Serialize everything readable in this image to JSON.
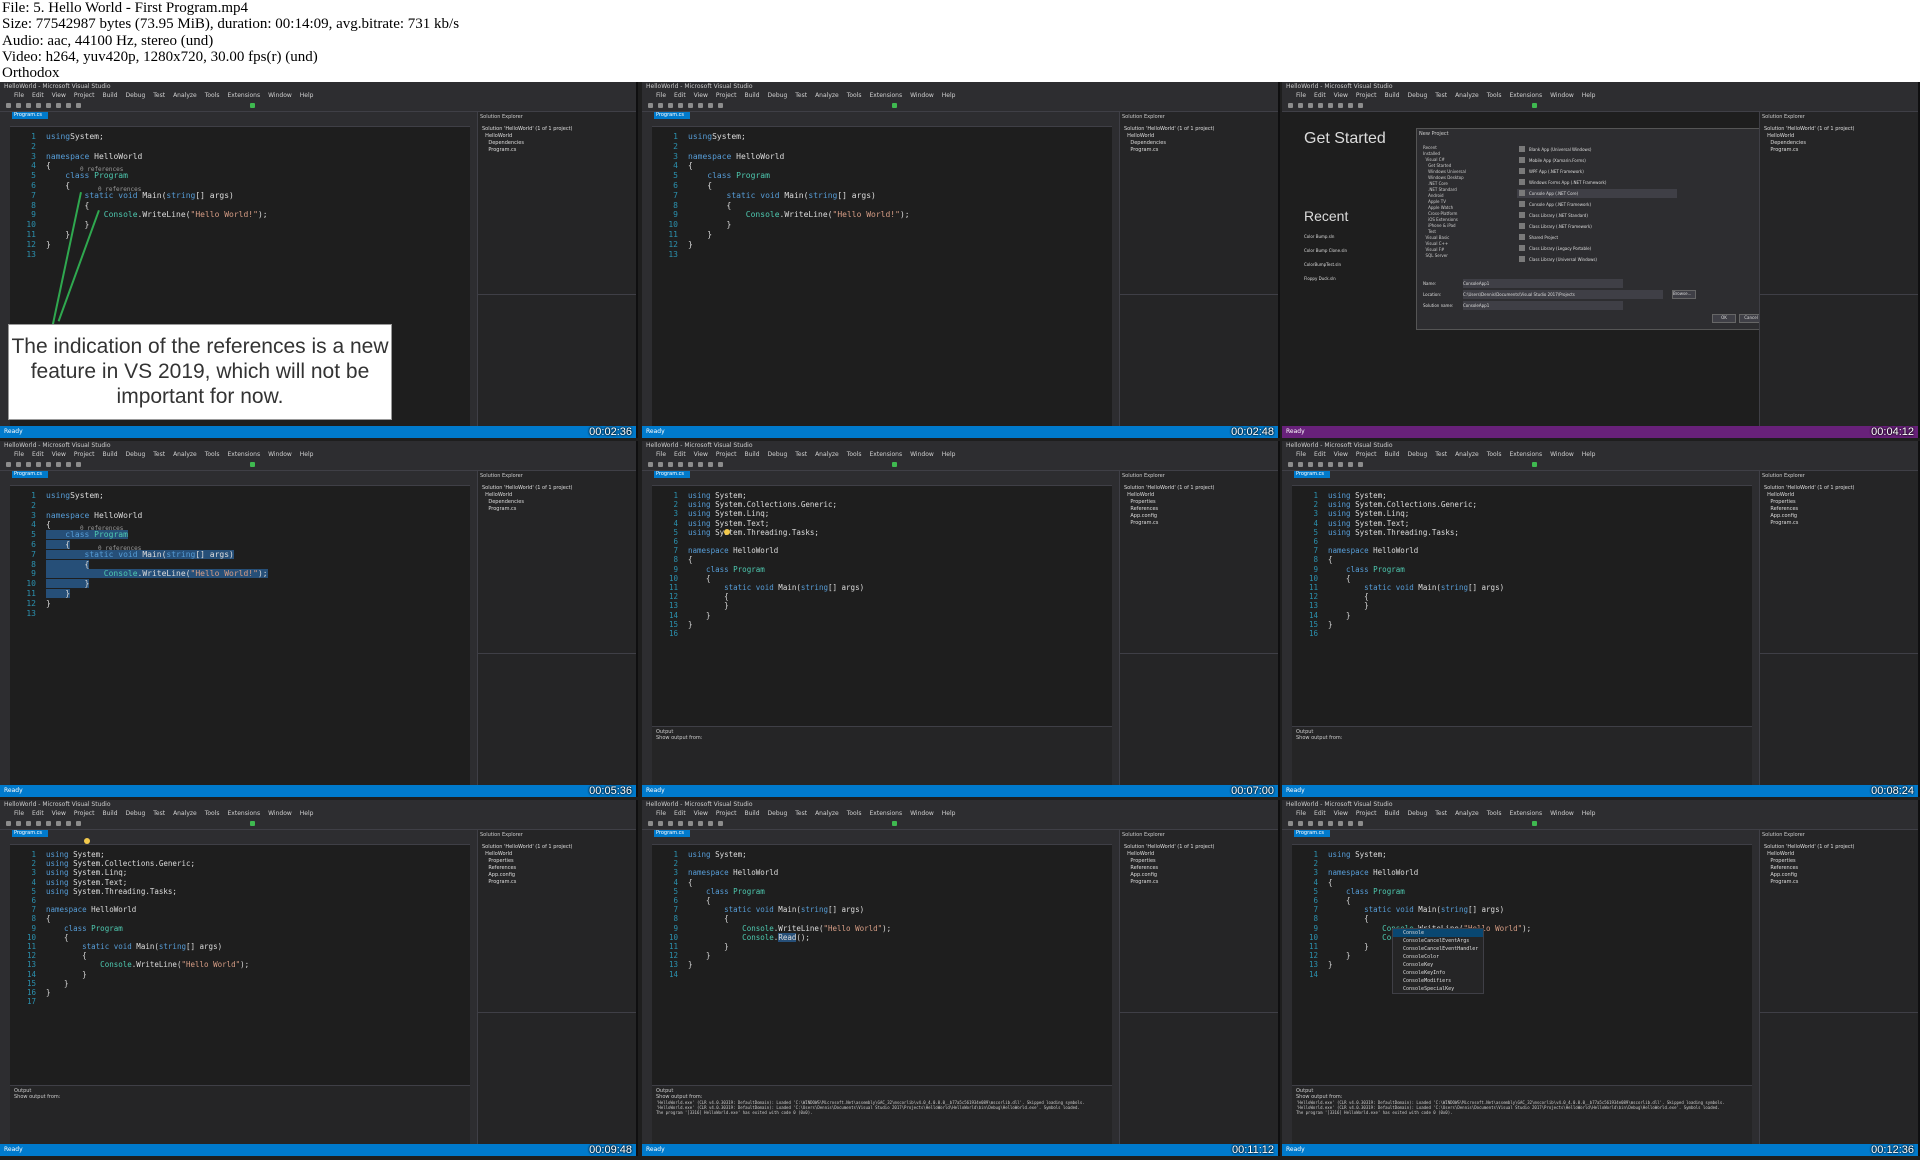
{
  "header": {
    "lines": [
      "File: 5. Hello World - First Program.mp4",
      "Size: 77542987 bytes (73.95 MiB), duration: 00:14:09, avg.bitrate: 731 kb/s",
      "Audio: aac, 44100 Hz, stereo (und)",
      "Video: h264, yuv420p, 1280x720, 30.00 fps(r) (und)",
      "Orthodox"
    ]
  },
  "menu": [
    "File",
    "Edit",
    "View",
    "Project",
    "Build",
    "Debug",
    "Test",
    "Analyze",
    "Tools",
    "Extensions",
    "Window",
    "Help"
  ],
  "app_title": "HelloWorld - Microsoft Visual Studio",
  "tab_label": "Program.cs",
  "status_ready": "Ready",
  "solution_explorer": {
    "title": "Solution Explorer",
    "core_tree": "Solution 'HelloWorld' (1 of 1 project)\n  HelloWorld\n    Dependencies\n    Program.cs",
    "fx_tree": "Solution 'HelloWorld' (1 of 1 project)\n  HelloWorld\n    Properties\n    References\n    App.config\n    Program.cs"
  },
  "output": {
    "label": "Output",
    "show_from": "Show output from:",
    "debug_text": "'HelloWorld.exe' (CLR v4.0.30319: DefaultDomain): Loaded 'C:\\WINDOWS\\Microsoft.Net\\assembly\\GAC_32\\mscorlib\\v4.0_4.0.0.0__b77a5c561934e089\\mscorlib.dll'. Skipped loading symbols.\n'HelloWorld.exe' (CLR v4.0.30319: DefaultDomain): Loaded 'C:\\Users\\Dennis\\Documents\\Visual Studio 2017\\Projects\\HelloWorld\\HelloWorld\\bin\\Debug\\HelloWorld.exe'. Symbols loaded.\nThe program '[3316] HelloWorld.exe' has exited with code 0 (0x0)."
  },
  "callout": "The indication of the references is a new feature in VS 2019, which will not be important for now.",
  "references_label": "0 references",
  "frames": [
    {
      "timestamp": "00:02:36",
      "lines": [
        [
          [
            "kw",
            "using"
          ],
          [
            "",
            "System;"
          ]
        ],
        [
          [
            "",
            ""
          ]
        ],
        [
          [
            "kw",
            "namespace"
          ],
          [
            "",
            " HelloWorld"
          ]
        ],
        [
          [
            "",
            "{"
          ]
        ],
        [
          [
            "kw",
            "    class"
          ],
          [
            "ty",
            " Program"
          ]
        ],
        [
          [
            "",
            "    {"
          ]
        ],
        [
          [
            "kw",
            "        static void"
          ],
          [
            "",
            " Main("
          ],
          [
            "kw",
            "string"
          ],
          [
            "",
            "[] args)"
          ]
        ],
        [
          [
            "",
            "        {"
          ]
        ],
        [
          [
            "ty",
            "            Console"
          ],
          [
            "",
            ".WriteLine("
          ],
          [
            "st",
            "\"Hello World!\""
          ],
          [
            "",
            ");"
          ]
        ],
        [
          [
            "",
            "        }"
          ]
        ],
        [
          [
            "",
            "    }"
          ]
        ],
        [
          [
            "",
            "}"
          ]
        ],
        [
          [
            "",
            ""
          ]
        ]
      ]
    },
    {
      "timestamp": "00:02:48",
      "lines": [
        [
          [
            "kw",
            "using"
          ],
          [
            "",
            "System;"
          ]
        ],
        [
          [
            "",
            ""
          ]
        ],
        [
          [
            "kw",
            "namespace"
          ],
          [
            "",
            " HelloWorld"
          ]
        ],
        [
          [
            "",
            "{"
          ]
        ],
        [
          [
            "kw",
            "    class"
          ],
          [
            "ty",
            " Program"
          ]
        ],
        [
          [
            "",
            "    {"
          ]
        ],
        [
          [
            "kw",
            "        static void"
          ],
          [
            "",
            " Main("
          ],
          [
            "kw",
            "string"
          ],
          [
            "",
            "[] args)"
          ]
        ],
        [
          [
            "",
            "        {"
          ]
        ],
        [
          [
            "ty",
            "            Console"
          ],
          [
            "",
            ".WriteLine("
          ],
          [
            "st",
            "\"Hello World!\""
          ],
          [
            "",
            ");"
          ]
        ],
        [
          [
            "",
            "        }"
          ]
        ],
        [
          [
            "",
            "    }"
          ]
        ],
        [
          [
            "",
            "}"
          ]
        ],
        [
          [
            "",
            ""
          ]
        ]
      ]
    },
    {
      "timestamp": "00:04:12",
      "get_started": "Get Started",
      "recent": "Recent",
      "dialog_title": "New Project",
      "templates": [
        "Blank App (Universal Windows)",
        "Mobile App (Xamarin.Forms)",
        "WPF App (.NET Framework)",
        "Windows Forms App (.NET Framework)",
        "Console App (.NET Core)",
        "Console App (.NET Framework)",
        "Class Library (.NET Standard)",
        "Class Library (.NET Framework)",
        "Shared Project",
        "Class Library (Legacy Portable)",
        "Class Library (Universal Windows)"
      ],
      "recent_items": [
        "Color Bump.sln",
        "Color Bump Clone.sln",
        "ColorBumpTest.sln",
        "Floppy Duck.sln"
      ],
      "tree": "Recent\nInstalled\n  Visual C#\n    Get Started\n    Windows Universal\n    Windows Desktop\n    .NET Core\n    .NET Standard\n    Android\n    Apple TV\n    Apple Watch\n    Cross-Platform\n    iOS Extensions\n    iPhone & iPad\n    Test\n  Visual Basic\n  Visual C++\n  Visual F#\n  SQL Server",
      "field_name": "Name:",
      "field_location": "Location:",
      "field_solution": "Solution name:",
      "value_name": "ConsoleApp1",
      "value_location": "C:\\Users\\Dennis\\Documents\\Visual Studio 2017\\Projects",
      "browse": "Browse...",
      "ok": "OK",
      "cancel": "Cancel"
    },
    {
      "timestamp": "00:05:36",
      "lines": [
        [
          [
            "kw",
            "using"
          ],
          [
            "",
            "System;"
          ]
        ],
        [
          [
            "",
            ""
          ]
        ],
        [
          [
            "kw",
            "namespace"
          ],
          [
            "",
            " HelloWorld"
          ]
        ],
        [
          [
            "",
            "{"
          ]
        ],
        [
          [
            "kw",
            "    class"
          ],
          [
            "ty",
            " Program"
          ]
        ],
        [
          [
            "",
            "    {"
          ]
        ],
        [
          [
            "kw",
            "        static void"
          ],
          [
            "",
            " Main("
          ],
          [
            "kw",
            "string"
          ],
          [
            "",
            "[] args)"
          ]
        ],
        [
          [
            "",
            "        {"
          ]
        ],
        [
          [
            "ty",
            "            Console"
          ],
          [
            "",
            ".WriteLine("
          ],
          [
            "st",
            "\"Hello World!\""
          ],
          [
            "",
            ");"
          ]
        ],
        [
          [
            "",
            "        }"
          ]
        ],
        [
          [
            "",
            "    }"
          ]
        ],
        [
          [
            "",
            "}"
          ]
        ],
        [
          [
            "",
            ""
          ]
        ]
      ]
    },
    {
      "timestamp": "00:07:00",
      "lines": [
        [
          [
            "kw",
            "using"
          ],
          [
            "",
            " System;"
          ]
        ],
        [
          [
            "kw",
            "using"
          ],
          [
            "",
            " System.Collections.Generic;"
          ]
        ],
        [
          [
            "kw",
            "using"
          ],
          [
            "",
            " System.Linq;"
          ]
        ],
        [
          [
            "kw",
            "using"
          ],
          [
            "",
            " System.Text;"
          ]
        ],
        [
          [
            "kw",
            "using"
          ],
          [
            "",
            " System.Threading.Tasks;"
          ]
        ],
        [
          [
            "",
            ""
          ]
        ],
        [
          [
            "kw",
            "namespace"
          ],
          [
            "",
            " HelloWorld"
          ]
        ],
        [
          [
            "",
            "{"
          ]
        ],
        [
          [
            "kw",
            "    class"
          ],
          [
            "ty",
            " Program"
          ]
        ],
        [
          [
            "",
            "    {"
          ]
        ],
        [
          [
            "kw",
            "        static void"
          ],
          [
            "",
            " Main("
          ],
          [
            "kw",
            "string"
          ],
          [
            "",
            "[] args)"
          ]
        ],
        [
          [
            "",
            "        {"
          ]
        ],
        [
          [
            "",
            "        }"
          ]
        ],
        [
          [
            "",
            "    }"
          ]
        ],
        [
          [
            "",
            "}"
          ]
        ],
        [
          [
            "",
            ""
          ]
        ]
      ]
    },
    {
      "timestamp": "00:08:24",
      "lines": [
        [
          [
            "kw",
            "using"
          ],
          [
            "",
            " System;"
          ]
        ],
        [
          [
            "kw",
            "using"
          ],
          [
            "",
            " System.Collections.Generic;"
          ]
        ],
        [
          [
            "kw",
            "using"
          ],
          [
            "",
            " System.Linq;"
          ]
        ],
        [
          [
            "kw",
            "using"
          ],
          [
            "",
            " System.Text;"
          ]
        ],
        [
          [
            "kw",
            "using"
          ],
          [
            "",
            " System.Threading.Tasks;"
          ]
        ],
        [
          [
            "",
            ""
          ]
        ],
        [
          [
            "kw",
            "namespace"
          ],
          [
            "",
            " HelloWorld"
          ]
        ],
        [
          [
            "",
            "{"
          ]
        ],
        [
          [
            "kw",
            "    class"
          ],
          [
            "ty",
            " Program"
          ]
        ],
        [
          [
            "",
            "    {"
          ]
        ],
        [
          [
            "kw",
            "        static void"
          ],
          [
            "",
            " Main("
          ],
          [
            "kw",
            "string"
          ],
          [
            "",
            "[] args)"
          ]
        ],
        [
          [
            "",
            "        {"
          ]
        ],
        [
          [
            "",
            "        }"
          ]
        ],
        [
          [
            "",
            "    }"
          ]
        ],
        [
          [
            "",
            "}"
          ]
        ],
        [
          [
            "",
            ""
          ]
        ]
      ]
    },
    {
      "timestamp": "00:09:48",
      "lines": [
        [
          [
            "kw",
            "using"
          ],
          [
            "",
            " System;"
          ]
        ],
        [
          [
            "kw",
            "using"
          ],
          [
            "",
            " System.Collections.Generic;"
          ]
        ],
        [
          [
            "kw",
            "using"
          ],
          [
            "",
            " System.Linq;"
          ]
        ],
        [
          [
            "kw",
            "using"
          ],
          [
            "",
            " System.Text;"
          ]
        ],
        [
          [
            "kw",
            "using"
          ],
          [
            "",
            " System.Threading.Tasks;"
          ]
        ],
        [
          [
            "",
            ""
          ]
        ],
        [
          [
            "kw",
            "namespace"
          ],
          [
            "",
            " HelloWorld"
          ]
        ],
        [
          [
            "",
            "{"
          ]
        ],
        [
          [
            "kw",
            "    class"
          ],
          [
            "ty",
            " Program"
          ]
        ],
        [
          [
            "",
            "    {"
          ]
        ],
        [
          [
            "kw",
            "        static void"
          ],
          [
            "",
            " Main("
          ],
          [
            "kw",
            "string"
          ],
          [
            "",
            "[] args)"
          ]
        ],
        [
          [
            "",
            "        {"
          ]
        ],
        [
          [
            "ty",
            "            Console"
          ],
          [
            "",
            ".WriteLine("
          ],
          [
            "st",
            "\"Hello World\""
          ],
          [
            "",
            ");"
          ]
        ],
        [
          [
            "",
            "        }"
          ]
        ],
        [
          [
            "",
            "    }"
          ]
        ],
        [
          [
            "",
            "}"
          ]
        ],
        [
          [
            "",
            ""
          ]
        ]
      ]
    },
    {
      "timestamp": "00:11:12",
      "lines": [
        [
          [
            "kw",
            "using"
          ],
          [
            "",
            " System;"
          ]
        ],
        [
          [
            "",
            ""
          ]
        ],
        [
          [
            "kw",
            "namespace"
          ],
          [
            "",
            " HelloWorld"
          ]
        ],
        [
          [
            "",
            "{"
          ]
        ],
        [
          [
            "kw",
            "    class"
          ],
          [
            "ty",
            " Program"
          ]
        ],
        [
          [
            "",
            "    {"
          ]
        ],
        [
          [
            "kw",
            "        static void"
          ],
          [
            "",
            " Main("
          ],
          [
            "kw",
            "string"
          ],
          [
            "",
            "[] args)"
          ]
        ],
        [
          [
            "",
            "        {"
          ]
        ],
        [
          [
            "ty",
            "            Console"
          ],
          [
            "",
            ".WriteLine("
          ],
          [
            "st",
            "\"Hello World\""
          ],
          [
            "",
            ");"
          ]
        ],
        [
          [
            "ty",
            "            Console"
          ],
          [
            "",
            "."
          ],
          [
            "sel",
            "Read"
          ],
          [
            "",
            "();"
          ]
        ],
        [
          [
            "",
            "        }"
          ]
        ],
        [
          [
            "",
            "    }"
          ]
        ],
        [
          [
            "",
            "}"
          ]
        ],
        [
          [
            "",
            ""
          ]
        ]
      ]
    },
    {
      "timestamp": "00:12:36",
      "lines": [
        [
          [
            "kw",
            "using"
          ],
          [
            "",
            " System;"
          ]
        ],
        [
          [
            "",
            ""
          ]
        ],
        [
          [
            "kw",
            "namespace"
          ],
          [
            "",
            " HelloWorld"
          ]
        ],
        [
          [
            "",
            "{"
          ]
        ],
        [
          [
            "kw",
            "    class"
          ],
          [
            "ty",
            " Program"
          ]
        ],
        [
          [
            "",
            "    {"
          ]
        ],
        [
          [
            "kw",
            "        static void"
          ],
          [
            "",
            " Main("
          ],
          [
            "kw",
            "string"
          ],
          [
            "",
            "[] args)"
          ]
        ],
        [
          [
            "",
            "        {"
          ]
        ],
        [
          [
            "ty",
            "            Console"
          ],
          [
            "",
            ".WriteLine("
          ],
          [
            "st",
            "\"Hello World\""
          ],
          [
            "",
            ");"
          ]
        ],
        [
          [
            "ty",
            "            Console"
          ]
        ],
        [
          [
            "",
            "        }"
          ]
        ],
        [
          [
            "",
            "    }"
          ]
        ],
        [
          [
            "",
            "}"
          ]
        ],
        [
          [
            "",
            ""
          ]
        ]
      ],
      "autocomplete": [
        "Console",
        "ConsoleCancelEventArgs",
        "ConsoleCancelEventHandler",
        "ConsoleColor",
        "ConsoleKey",
        "ConsoleKeyInfo",
        "ConsoleModifiers",
        "ConsoleSpecialKey"
      ]
    }
  ],
  "colors": {
    "accent": "#007acc",
    "purple_status": "#68217a",
    "editor_bg": "#1e1e1e",
    "chrome_bg": "#2d2d30"
  }
}
